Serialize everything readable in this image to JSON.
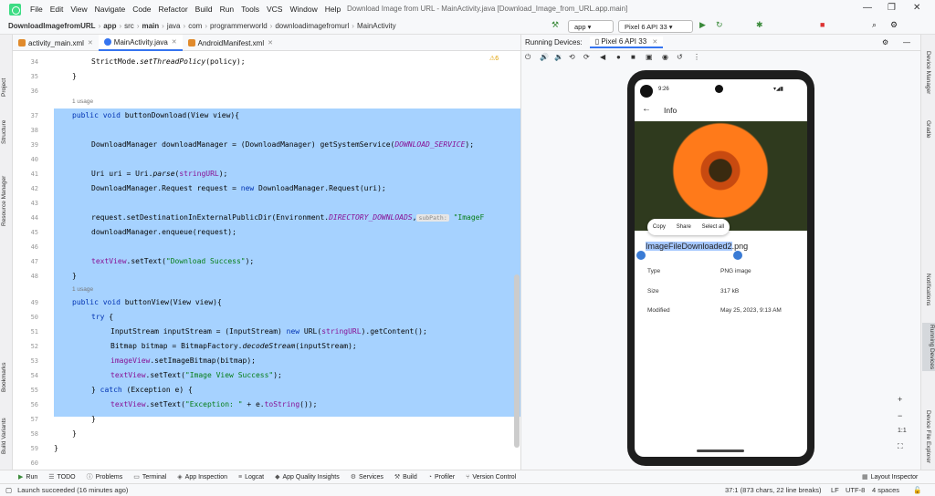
{
  "menu": [
    "File",
    "Edit",
    "View",
    "Navigate",
    "Code",
    "Refactor",
    "Build",
    "Run",
    "Tools",
    "VCS",
    "Window",
    "Help"
  ],
  "window_title": "Download Image from URL - MainActivity.java [Download_Image_from_URL.app.main]",
  "breadcrumbs": [
    "DownloadImagefromURL",
    "app",
    "src",
    "main",
    "java",
    "com",
    "programmerworld",
    "downloadimagefromurl",
    "MainActivity"
  ],
  "run_config": "app",
  "device_select": "Pixel 6 API 33",
  "editor_tabs": [
    {
      "label": "activity_main.xml",
      "color": "#e08a2c"
    },
    {
      "label": "MainActivity.java",
      "color": "#3574f0"
    },
    {
      "label": "AndroidManifest.xml",
      "color": "#e08a2c"
    }
  ],
  "warnings": "⚠6",
  "line_numbers": [
    "34",
    "35",
    "36",
    "37",
    "38",
    "39",
    "40",
    "41",
    "42",
    "43",
    "44",
    "45",
    "46",
    "47",
    "48",
    "49",
    "50",
    "51",
    "52",
    "53",
    "54",
    "55",
    "56",
    "57",
    "58",
    "59",
    "60"
  ],
  "usage_label": "1 usage",
  "hint_label": "subPath:",
  "code": {
    "l34": "StrictMode.",
    "l34b": "setThreadPolicy",
    "l34c": "(policy);",
    "l35": "}",
    "l37a": "public void",
    "l37b": " buttonDownload(View view){",
    "l39a": "DownloadManager downloadManager = (DownloadManager) getSystemService(",
    "l39b": "DOWNLOAD_SERVICE",
    "l39c": ");",
    "l41a": "Uri uri = Uri.",
    "l41b": "parse",
    "l41c": "(",
    "l41d": "stringURL",
    "l41e": ");",
    "l42a": "DownloadManager.Request request = ",
    "l42b": "new",
    "l42c": " DownloadManager.Request(uri);",
    "l44a": "request.setDestinationInExternalPublicDir(Environment.",
    "l44b": "DIRECTORY_DOWNLOADS",
    "l44c": ",",
    "l44d": " \"ImageF",
    "l45": "downloadManager.enqueue(request);",
    "l47a": "textView",
    "l47b": ".setText(",
    "l47c": "\"Download Success\"",
    "l47d": ");",
    "l48": "}",
    "l50a": "public void",
    "l50b": " buttonView(View view){",
    "l51a": "try",
    "l51b": " {",
    "l52a": "InputStream inputStream = (InputStream) ",
    "l52b": "new",
    "l52c": " URL(",
    "l52d": "stringURL",
    "l52e": ").getContent();",
    "l53a": "Bitmap bitmap = BitmapFactory.",
    "l53b": "decodeStream",
    "l53c": "(inputStream);",
    "l54a": "imageView",
    "l54b": ".setImageBitmap(bitmap);",
    "l55a": "textView",
    "l55b": ".setText(",
    "l55c": "\"Image View Success\"",
    "l55d": ");",
    "l56a": "} ",
    "l56b": "catch",
    "l56c": " (Exception e) {",
    "l57a": "textView",
    "l57b": ".setText(",
    "l57c": "\"Exception: \"",
    "l57d": " + e.",
    "l57e": "toString",
    "l57f": "());",
    "l58": "}",
    "l59": "}",
    "l60": "}"
  },
  "running_devices": {
    "label": "Running Devices:",
    "tab": "Pixel 6 API 33"
  },
  "phone": {
    "time": "9:26",
    "title": "Info",
    "ctx_copy": "Copy",
    "ctx_share": "Share",
    "ctx_selectall": "Select all",
    "file_selected": "ImageFileDownloaded2",
    "file_ext": ".png",
    "type_label": "Type",
    "type_value": "PNG image",
    "size_label": "Size",
    "size_value": "317 kB",
    "modified_label": "Modified",
    "modified_value": "May 25, 2023, 9:13 AM"
  },
  "zoom": {
    "plus": "+",
    "minus": "−",
    "ratio": "1:1"
  },
  "left_strip": [
    "Project",
    "Structure",
    "Resource Manager",
    "Bookmarks",
    "Build Variants"
  ],
  "right_strip": [
    "Device Manager",
    "Gradle",
    "Notifications",
    "Running Devices",
    "Device File Explorer"
  ],
  "bottom_tools": [
    "Run",
    "TODO",
    "Problems",
    "Terminal",
    "App Inspection",
    "Logcat",
    "App Quality Insights",
    "Services",
    "Build",
    "Profiler",
    "Version Control"
  ],
  "layout_inspector": "Layout Inspector",
  "status": {
    "message": "Launch succeeded (16 minutes ago)",
    "position": "37:1 (873 chars, 22 line breaks)",
    "line_sep": "LF",
    "encoding": "UTF-8",
    "indent": "4 spaces"
  }
}
